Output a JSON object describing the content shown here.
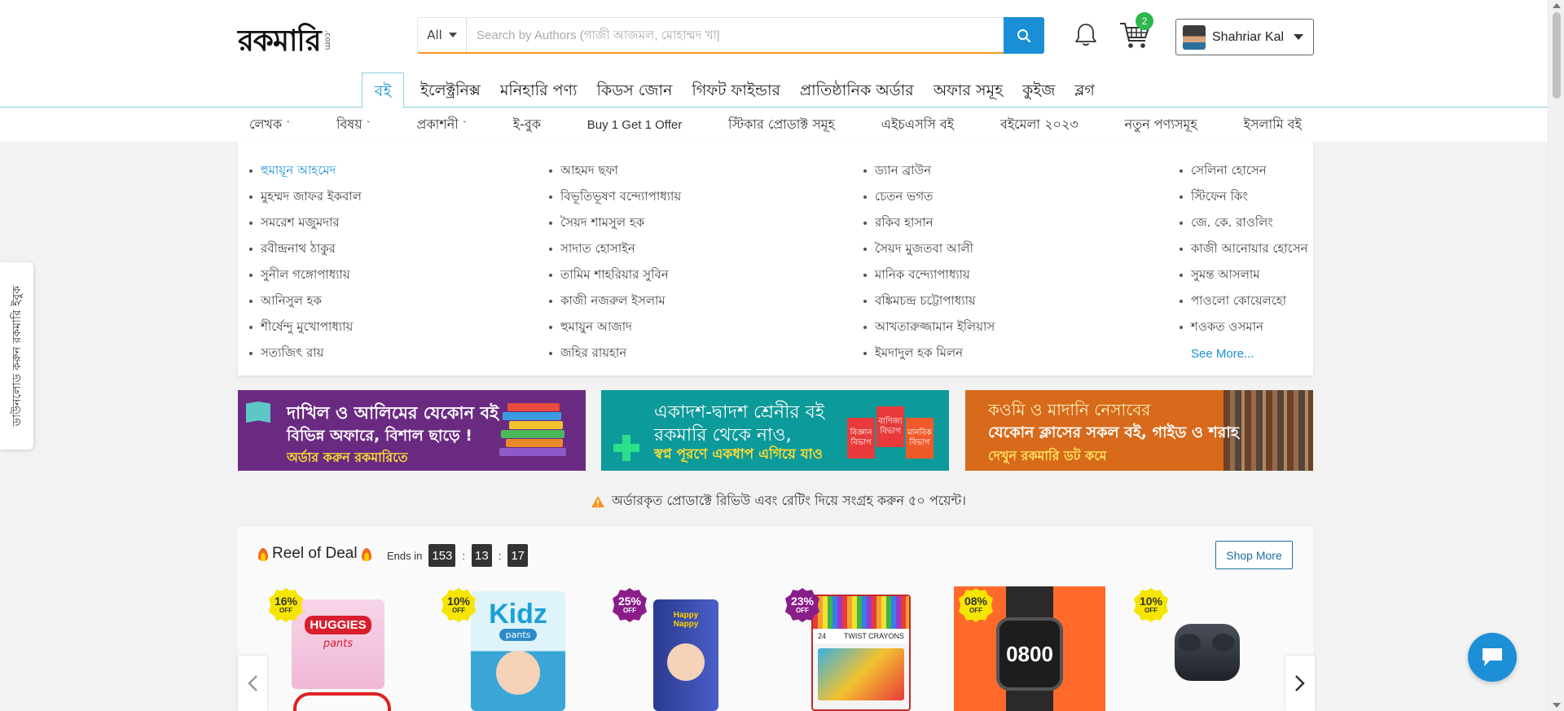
{
  "header": {
    "logo_text": "রকমারি",
    "logo_suffix": ".com",
    "search": {
      "category": "All",
      "placeholder": "Search by Authors (গাজী আজমল, মোহাম্মদ খা|"
    },
    "cart_count": "2",
    "user_name": "Shahriar Kal"
  },
  "main_nav": [
    "বই",
    "ইলেক্ট্রনিক্স",
    "মনিহারি পণ্য",
    "কিডস জোন",
    "গিফট ফাইন্ডার",
    "প্রাতিষ্ঠানিক অর্ডার",
    "অফার সমূহ",
    "কুইজ",
    "ব্লগ"
  ],
  "sub_nav": {
    "writer": "লেখক",
    "subject": "বিষয়",
    "publisher": "প্রকাশনী",
    "ebook": "ই-বুক",
    "offer": "Buy 1 Get 1 Offer",
    "sticker": "স্টিকার প্রোডাক্ট সমূহ",
    "hsc": "এইচএসসি বই",
    "fair": "বইমেলা ২০২৩",
    "new": "নতুন পণ্যসমূহ",
    "islamic": "ইসলামি বই"
  },
  "authors": {
    "col1": [
      "হুমায়ূন আহমেদ",
      "মুহম্মদ জাফর ইকবাল",
      "সমরেশ মজুমদার",
      "রবীন্দ্রনাথ ঠাকুর",
      "সুনীল গঙ্গোপাধ্যায়",
      "আনিসুল হক",
      "শীর্ষেন্দু মুখোপাধ্যায়",
      "সত্যজিৎ রায়"
    ],
    "col2": [
      "আহমদ ছফা",
      "বিভূতিভূষণ বন্দ্যোপাধ্যায়",
      "সৈয়দ শামসুল হক",
      "সাদাত হোসাইন",
      "তামিম শাহরিয়ার সুবিন",
      "কাজী নজরুল ইসলাম",
      "হুমায়ুন আজাদ",
      "জহির রায়হান"
    ],
    "col3": [
      "ড্যান ব্রাউন",
      "চেতন ভগত",
      "রকিব হাসান",
      "সৈয়দ মুজতবা আলী",
      "মানিক বন্দ্যোপাধ্যায়",
      "বঙ্কিমচন্দ্র চট্টোপাধ্যায়",
      "আখতারুজ্জামান ইলিয়াস",
      "ইমদাদুল হক মিলন"
    ],
    "col4": [
      "সেলিনা হোসেন",
      "স্টিফেন কিং",
      "জে. কে. রাওলিং",
      "কাজী আনোয়ার হোসেন",
      "সুমন্ত আসলাম",
      "পাওলো কোয়েলহো",
      "শওকত ওসমান"
    ],
    "see_more": "See More..."
  },
  "side_tab": "ডাউনলোড করুন রকমারি ইবুক",
  "banners": [
    {
      "title": "দাখিল ও আলিমের যেকোন বই",
      "sub": "বিভিন্ন অফারে, বিশাল ছাড়ে !",
      "cta": "অর্ডার করুন রকমারিতে"
    },
    {
      "title": "একাদশ-দ্বাদশ শ্রেনীর বই",
      "sub": "রকমারি থেকে নাও,",
      "cta": "স্বপ্ন পূরণে একধাপ এগিয়ে যাও",
      "tag1": "বিজ্ঞান বিভাগ",
      "tag2": "বাণিজ্য বিভাগ",
      "tag3": "মানবিক বিভাগ"
    },
    {
      "title": "কওমি ও মাদানি নেসাবের",
      "sub": "যেকোন ক্লাসের সকল বই, গাইড ও শরাহ",
      "cta": "দেখুন রকমারি ডট কমে"
    }
  ],
  "notice": "অর্ডারকৃত প্রোডাক্টে রিভিউ এবং রেটিং দিয়ে সংগ্রহ করুন ৫০ পয়েন্ট।",
  "deal": {
    "title": "Reel of Deal",
    "ends_label": "Ends in",
    "days": "153",
    "hours": "13",
    "minutes": "17",
    "shop_more": "Shop More",
    "products": [
      {
        "discount": "16%",
        "off": "OFF",
        "badge": "yellow",
        "brand": "HUGGIES",
        "brand_sub": "pants"
      },
      {
        "discount": "10%",
        "off": "OFF",
        "badge": "yellow",
        "brand": "Kidz",
        "brand_sub": "pants"
      },
      {
        "discount": "25%",
        "off": "OFF",
        "badge": "purple",
        "brand": "Happy Nappy",
        "brand_sub": ""
      },
      {
        "discount": "23%",
        "off": "OFF",
        "badge": "purple",
        "brand": "24",
        "brand_sub": "TWIST CRAYONS"
      },
      {
        "discount": "08%",
        "off": "OFF",
        "badge": "yellow",
        "brand": "0800",
        "brand_sub": ""
      },
      {
        "discount": "10%",
        "off": "OFF",
        "badge": "yellow",
        "brand": "",
        "brand_sub": ""
      }
    ]
  },
  "colors": {
    "brand_blue": "#1a8fd6",
    "search_underline": "#f7941d",
    "badge_green": "#2db84b",
    "banner_purple": "#6b2a82",
    "banner_teal": "#0d9a9a",
    "banner_orange": "#d76a1b"
  }
}
